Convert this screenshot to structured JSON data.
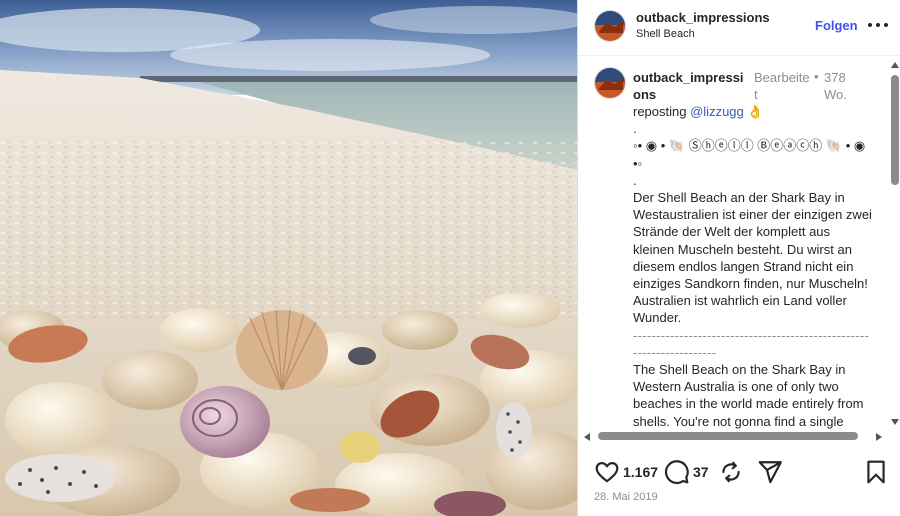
{
  "post": {
    "username": "outback_impressions",
    "location": "Shell Beach",
    "follow_label": "Folgen",
    "more_icon": "more-horizontal-icon"
  },
  "comment": {
    "username": "outback_impressions",
    "edited_label": "Bearbeitet",
    "dot": "•",
    "age": "378 Wo.",
    "caption_intro": "reposting ",
    "mention": "@lizzugg",
    "emoji": "👌",
    "dot_line1": ".",
    "decor_line": "◦• ◉ • 🐚 Ⓢⓗⓔⓛⓛ Ⓑⓔⓐⓒⓗ 🐚 • ◉ •◦",
    "dot_line2": ".",
    "german_text": "Der Shell Beach an der Shark Bay in Westaustralien ist einer der einzigen zwei Strände der Welt der komplett aus kleinen Muscheln besteht. Du wirst an diesem endlos langen Strand nicht ein einziges Sandkorn finden, nur Muscheln! Australien ist wahrlich ein Land voller Wunder.",
    "separator": "---------------------------------------------------------------------",
    "english_text": "The Shell Beach on the Shark Bay in Western Australia is one of only two beaches in the world made entirely from shells. You're not gonna find a single grain of sand on this endless beach, only shells!"
  },
  "actions": {
    "like_icon": "heart-icon",
    "likes": "1.167",
    "comment_icon": "comment-icon",
    "comments": "37",
    "repost_icon": "repost-icon",
    "share_icon": "send-icon",
    "save_icon": "bookmark-icon"
  },
  "date": "28. Mai 2019",
  "colors": {
    "accent": "#4150f7",
    "mention": "#3b5bb5",
    "muted": "#8e8e8e",
    "text": "#262626"
  }
}
